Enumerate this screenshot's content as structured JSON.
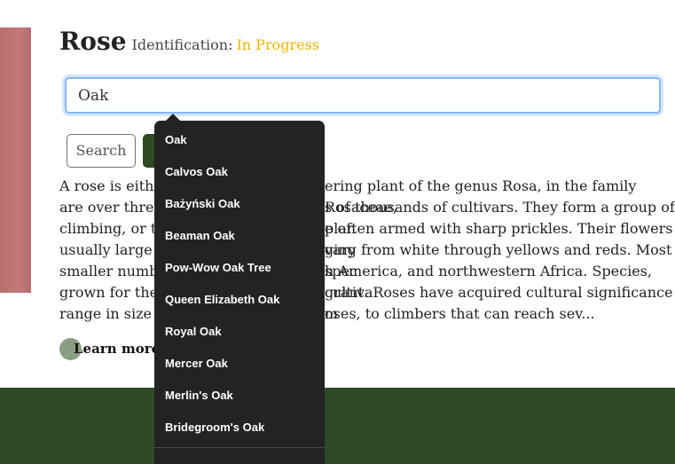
{
  "header": {
    "title": "Rose",
    "identification_label": "Identification:",
    "identification_status": "In Progress",
    "status_color": "#f0b400"
  },
  "search": {
    "value": "Oak",
    "button_label": "Search"
  },
  "suggestions": [
    "Oak",
    "Calvos Oak",
    "Bażyński Oak",
    "Beaman Oak",
    "Pow-Wow Oak Tree",
    "Queen Elizabeth Oak",
    "Royal Oak",
    "Mercer Oak",
    "Merlin's Oak",
    "Bridegroom's Oak"
  ],
  "description": {
    "lines": [
      "A rose is eithe",
      "ering plant of the genus Rosa, in the family Rosaceae,",
      "are over three",
      "s of thousands of cultivars. They form a group of plan",
      "climbing, or tr",
      "e often armed with sharp prickles. Their flowers vary",
      "usually large a",
      "ging from white through yellows and reds. Most spec",
      "smaller numbe",
      "h America, and northwestern Africa. Species, cultiva",
      "grown for thei",
      "grant. Roses have acquired cultural significance in m",
      "range in size f",
      "oses, to climbers that can reach sev..."
    ]
  },
  "learn_more": "Learn more",
  "colors": {
    "footer": "#2e4a25",
    "dropdown_bg": "#232323",
    "focus_ring": "#86b7fe"
  }
}
